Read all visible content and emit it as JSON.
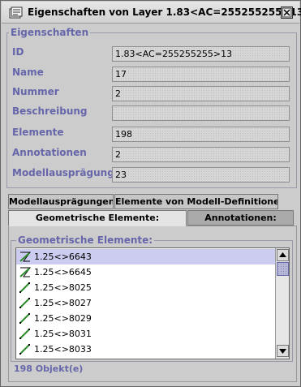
{
  "window": {
    "title": "Eigenschaften von Layer 1.83<AC=255255255>13",
    "icon": "layer-properties-icon",
    "close_icon": "close-x-icon"
  },
  "properties_group": {
    "legend": "Eigenschaften",
    "rows": [
      {
        "label": "ID",
        "value": "1.83<AC=255255255>13"
      },
      {
        "label": "Name",
        "value": "17"
      },
      {
        "label": "Nummer",
        "value": "2"
      },
      {
        "label": "Beschreibung",
        "value": ""
      },
      {
        "label": "Elemente",
        "value": "198"
      },
      {
        "label": "Annotationen",
        "value": "2"
      },
      {
        "label": "Modellausprägungen",
        "value": "23"
      }
    ]
  },
  "tabs": {
    "row1": [
      "Modellausprägungen:",
      "Elemente von Modell-Definitionen:"
    ],
    "row2": [
      "Geometrische Elemente:",
      "Annotationen:"
    ],
    "selected": "Geometrische Elemente:"
  },
  "elements_group": {
    "legend": "Geometrische Elemente:",
    "items": [
      {
        "label": "1.25<>6643",
        "icon": "polyline-element-icon",
        "selected": true
      },
      {
        "label": "1.25<>6645",
        "icon": "polyline-element-icon",
        "selected": false
      },
      {
        "label": "1.25<>8025",
        "icon": "line-element-icon",
        "selected": false
      },
      {
        "label": "1.25<>8027",
        "icon": "line-element-icon",
        "selected": false
      },
      {
        "label": "1.25<>8029",
        "icon": "line-element-icon",
        "selected": false
      },
      {
        "label": "1.25<>8031",
        "icon": "line-element-icon",
        "selected": false
      },
      {
        "label": "1.25<>8033",
        "icon": "line-element-icon",
        "selected": false
      }
    ],
    "status": "198 Objekt(e)"
  },
  "colors": {
    "label_color": "#6666aa",
    "selection_color": "#ccccf0",
    "element_icon_green": "#2e8b2e"
  }
}
